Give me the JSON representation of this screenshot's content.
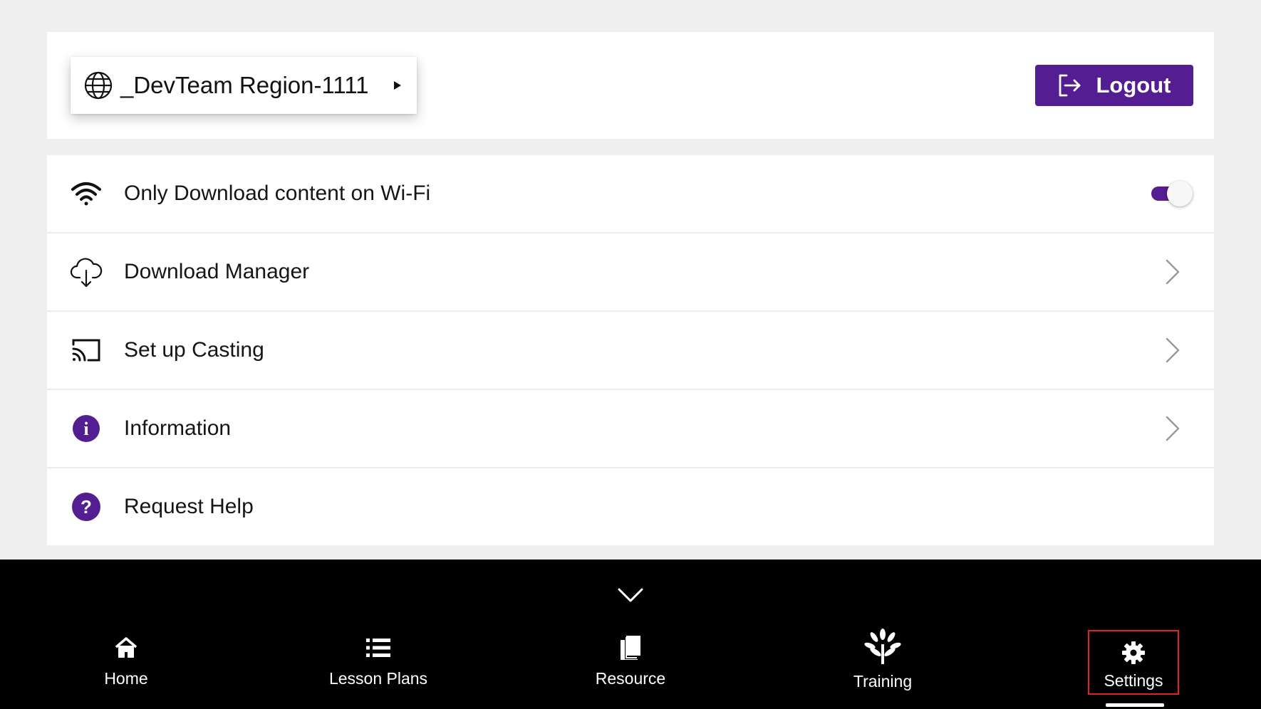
{
  "header": {
    "region_label": "_DevTeam Region-1111",
    "logout_label": "Logout"
  },
  "settings": {
    "items": [
      {
        "label": "Only Download content on Wi-Fi",
        "icon": "wifi-icon",
        "control": "toggle",
        "toggle_on": true
      },
      {
        "label": "Download Manager",
        "icon": "cloud-download-icon",
        "control": "chevron"
      },
      {
        "label": "Set up Casting",
        "icon": "cast-icon",
        "control": "chevron"
      },
      {
        "label": "Information",
        "icon": "info-icon",
        "control": "chevron"
      },
      {
        "label": "Request Help",
        "icon": "help-icon",
        "control": "none"
      }
    ]
  },
  "bottom_nav": {
    "items": [
      {
        "label": "Home",
        "icon": "home-icon"
      },
      {
        "label": "Lesson Plans",
        "icon": "list-icon"
      },
      {
        "label": "Resource",
        "icon": "book-icon"
      },
      {
        "label": "Training",
        "icon": "tree-icon"
      },
      {
        "label": "Settings",
        "icon": "gear-icon",
        "active": true
      }
    ]
  },
  "colors": {
    "accent": "#541d91",
    "background": "#efefef",
    "card": "#ffffff",
    "nav_background": "#000000",
    "highlight_border": "#e0202a"
  }
}
